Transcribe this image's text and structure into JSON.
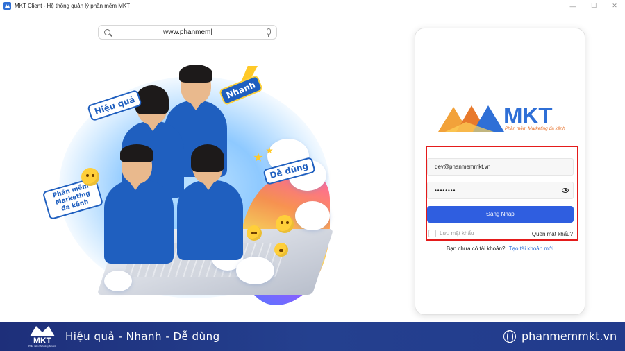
{
  "window": {
    "title": "MKT Client - Hệ thống quản lý phần mềm MKT",
    "controls": [
      "minimize",
      "maximize",
      "close"
    ]
  },
  "search": {
    "value": "www.phanmem|"
  },
  "hero": {
    "stickers": {
      "hieu_qua": "Hiệu quả",
      "nhanh": "Nhanh",
      "de_dung": "Dễ dùng",
      "phan_mem": "Phần mềm Marketing đa kênh"
    }
  },
  "login": {
    "logo_text": "MKT",
    "logo_subtitle": "Phần mềm Marketing đa kênh",
    "email_value": "dev@phanmemmkt.vn",
    "password_value": "••••••••",
    "login_button": "Đăng Nhập",
    "remember_label": "Lưu mật khẩu",
    "forgot_label": "Quên mật khẩu?",
    "no_account_text": "Bạn chưa có tài khoản?",
    "create_account_link": "Tạo tài khoản mới"
  },
  "footer": {
    "logo_text": "MKT",
    "logo_tiny": "Phần mềm Marketing đa kênh",
    "tagline": "Hiệu quả - Nhanh - Dễ dùng",
    "website": "phanmemmkt.vn"
  },
  "colors": {
    "accent_blue": "#2f5ee0",
    "highlight_red": "#e41b1b",
    "footer_navy": "#1e2f7a",
    "logo_orange": "#e66a1f"
  }
}
